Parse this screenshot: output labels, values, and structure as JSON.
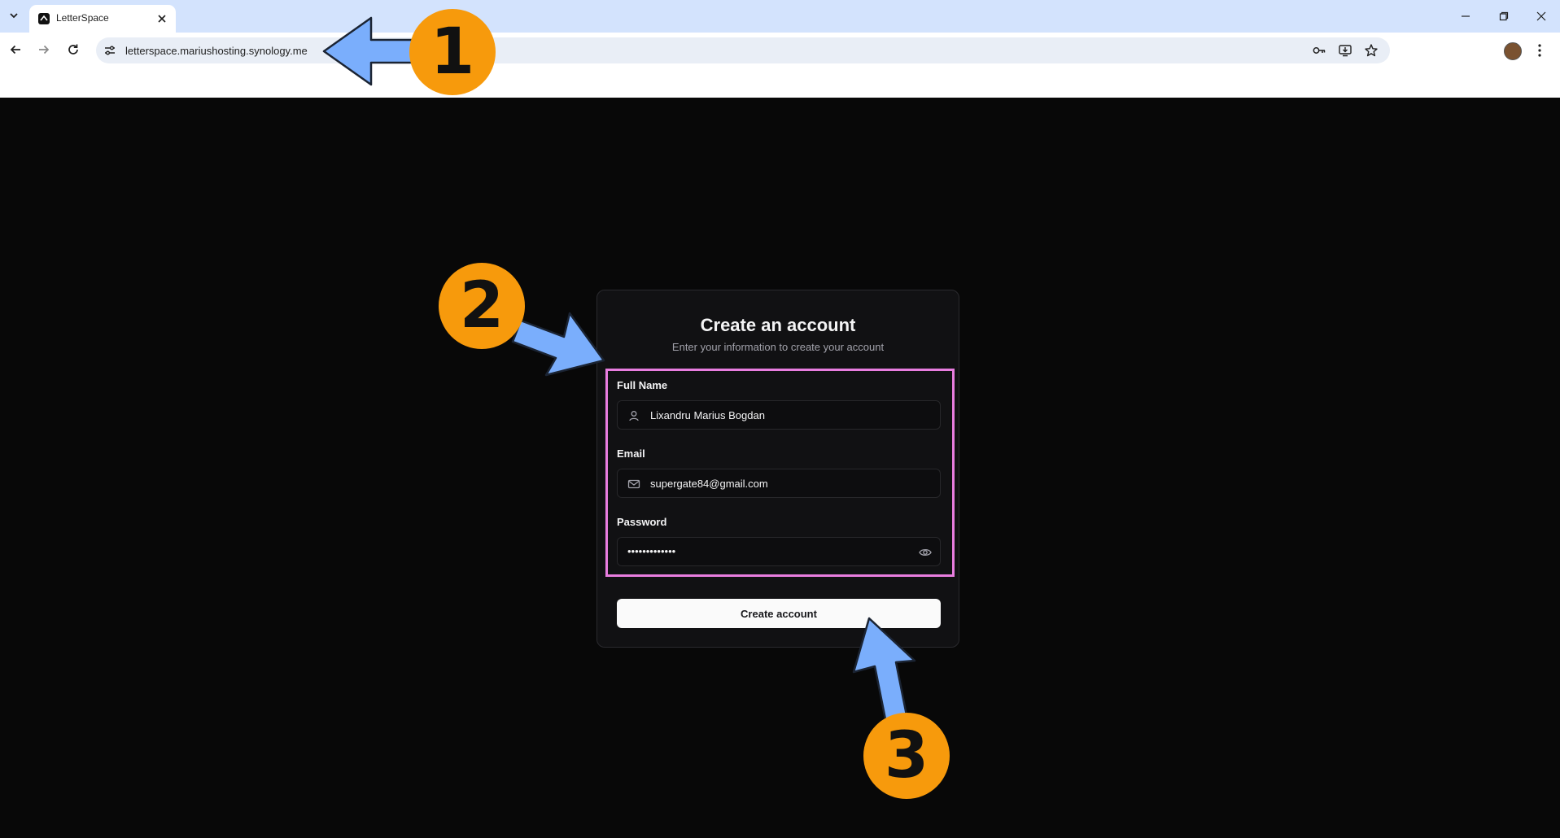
{
  "browser": {
    "tab_title": "LetterSpace",
    "url": "letterspace.mariushosting.synology.me"
  },
  "form": {
    "title": "Create an account",
    "subtitle": "Enter your information to create your account",
    "full_name_label": "Full Name",
    "full_name_value": "Lixandru Marius Bogdan",
    "email_label": "Email",
    "email_value": "supergate84@gmail.com",
    "password_label": "Password",
    "password_masked": "•••••••••••••",
    "submit_label": "Create account"
  },
  "annotations": {
    "step1": "1",
    "step2": "2",
    "step3": "3"
  },
  "colors": {
    "page_bg": "#080808",
    "card_bg": "#111113",
    "badge": "#f79a0c",
    "arrow": "#7aaefc",
    "highlight": "#e87ddf",
    "tabstrip": "#d3e3fd"
  },
  "icons": [
    "chevron-down-icon",
    "letterspace-favicon",
    "close-icon",
    "minimize-icon",
    "restore-icon",
    "back-icon",
    "forward-icon",
    "reload-icon",
    "site-info-icon",
    "password-key-icon",
    "install-app-icon",
    "star-icon",
    "user-icon",
    "mail-icon",
    "eye-icon"
  ]
}
